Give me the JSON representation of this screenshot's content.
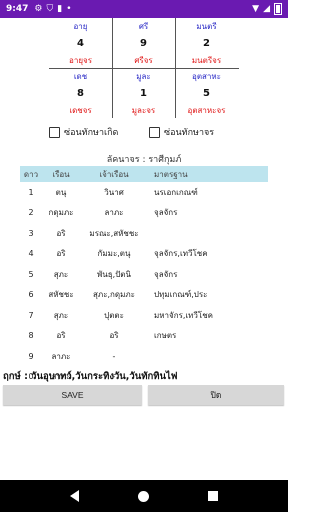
{
  "status_bar": {
    "time": "9:47",
    "left_icons": [
      "gear-icon",
      "shield-icon",
      "sim-icon",
      "dot-icon"
    ],
    "right_icons": [
      "wifi-icon",
      "signal-icon",
      "battery-icon"
    ]
  },
  "grid": [
    {
      "name": "อายุ",
      "num": "4",
      "sub": "อายุจร"
    },
    {
      "name": "ศรี",
      "num": "9",
      "sub": "ศรีจร"
    },
    {
      "name": "มนตรี",
      "num": "2",
      "sub": "มนตรีจร"
    },
    {
      "name": "เดช",
      "num": "8",
      "sub": "เดชจร"
    },
    {
      "name": "มูละ",
      "num": "1",
      "sub": "มูละจร"
    },
    {
      "name": "อุตสาหะ",
      "num": "5",
      "sub": "อุตสาหะจร"
    }
  ],
  "checkboxes": {
    "hide_birth": "ซ่อนทักษาเกิด",
    "hide_transit": "ซ่อนทักษาจร"
  },
  "lagna_title": "ลัคนาจร : ราศีกุมภ์",
  "table": {
    "headers": [
      "ดาว",
      "เรือน",
      "เจ้าเรือน",
      "มาตรฐาน"
    ],
    "rows": [
      [
        "1",
        "ตนุ",
        "วินาศ",
        "นรเอกเกณฑ์"
      ],
      [
        "2",
        "กดุมภะ",
        "ลาภะ",
        "จุลจักร"
      ],
      [
        "3",
        "อริ",
        "มรณะ,สหัชชะ",
        ""
      ],
      [
        "4",
        "อริ",
        "กัมมะ,ตนุ",
        "จุลจักร,เทวีโชค"
      ],
      [
        "5",
        "สุภะ",
        "พันธุ,ปัตนิ",
        "จุลจักร"
      ],
      [
        "6",
        "สหัชชะ",
        "สุภะ,กดุมภะ",
        "ปทุมเกณฑ์,ประ"
      ],
      [
        "7",
        "สุภะ",
        "ปุตตะ",
        "มหาจักร,เทวีโชค"
      ],
      [
        "8",
        "อริ",
        "อริ",
        "เกษตร"
      ],
      [
        "9",
        "ลาภะ",
        "-",
        ""
      ],
      [
        "0",
        "ลาภะ",
        "-",
        ""
      ]
    ]
  },
  "auspicious": "ฤกษ์ : วันอุบาทว์,วันกระทิงวัน,วันทักทินไฟ",
  "buttons": {
    "save": "SAVE",
    "close": "ปิด"
  }
}
